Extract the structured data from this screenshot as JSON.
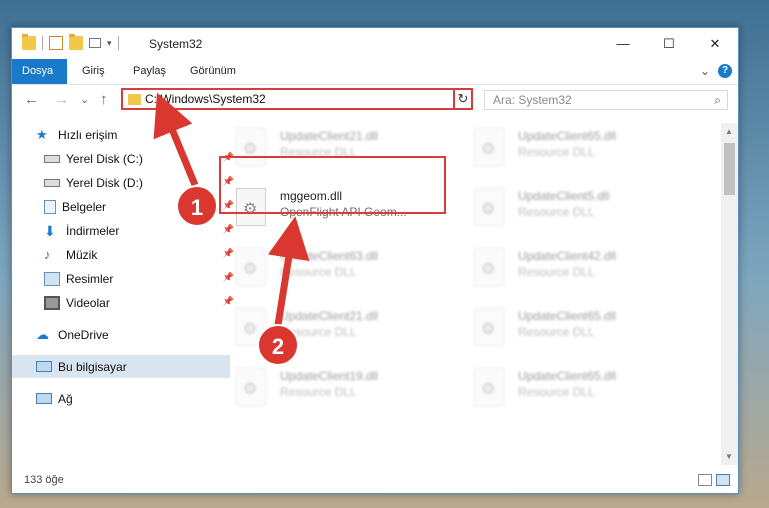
{
  "window": {
    "title": "System32",
    "controls": {
      "minimize": "—",
      "maximize": "☐",
      "close": "✕"
    }
  },
  "ribbon": {
    "tabs": [
      "Dosya",
      "Giriş",
      "Paylaş",
      "Görünüm"
    ],
    "expand": "⌄",
    "help": "?"
  },
  "navigation": {
    "back": "←",
    "forward": "→",
    "recent": "⌄",
    "up": "↑",
    "address": "C:\\Windows\\System32",
    "address_dropdown": "⌄",
    "refresh": "↻",
    "search_placeholder": "Ara: System32",
    "search_icon": "⌕"
  },
  "sidebar": {
    "items": [
      {
        "label": "Hızlı erişim",
        "icon": "star-icon",
        "pinned": false
      },
      {
        "label": "Yerel Disk (C:)",
        "icon": "drive-icon",
        "pinned": true
      },
      {
        "label": "Yerel Disk (D:)",
        "icon": "drive-icon",
        "pinned": true
      },
      {
        "label": "Belgeler",
        "icon": "document-icon",
        "pinned": true
      },
      {
        "label": "İndirmeler",
        "icon": "download-icon",
        "pinned": true
      },
      {
        "label": "Müzik",
        "icon": "music-icon",
        "pinned": true
      },
      {
        "label": "Resimler",
        "icon": "pictures-icon",
        "pinned": true
      },
      {
        "label": "Videolar",
        "icon": "video-icon",
        "pinned": true
      },
      {
        "label": "OneDrive",
        "icon": "cloud-icon",
        "pinned": false
      },
      {
        "label": "Bu bilgisayar",
        "icon": "computer-icon",
        "pinned": false,
        "selected": true
      },
      {
        "label": "Ağ",
        "icon": "network-icon",
        "pinned": false
      }
    ]
  },
  "files": [
    {
      "name": "UpdateClient21.dll",
      "desc": "Resource DLL",
      "blurred": true
    },
    {
      "name": "UpdateClient65.dll",
      "desc": "Resource DLL",
      "blurred": true
    },
    {
      "name": "mggeom.dll",
      "desc": "OpenFlight API Geom...",
      "blurred": false,
      "highlighted": true
    },
    {
      "name": "UpdateClient5.dll",
      "desc": "Resource DLL",
      "blurred": true
    },
    {
      "name": "UpdateClient63.dll",
      "desc": "Resource DLL",
      "blurred": true
    },
    {
      "name": "UpdateClient42.dll",
      "desc": "Resource DLL",
      "blurred": true
    },
    {
      "name": "UpdateClient21.dll",
      "desc": "Resource DLL",
      "blurred": true
    },
    {
      "name": "UpdateClient65.dll",
      "desc": "Resource DLL",
      "blurred": true
    },
    {
      "name": "UpdateClient19.dll",
      "desc": "Resource DLL",
      "blurred": true
    },
    {
      "name": "UpdateClient65.dll",
      "desc": "Resource DLL",
      "blurred": true
    }
  ],
  "status": {
    "count": "133 öğe"
  },
  "markers": {
    "one": "1",
    "two": "2"
  },
  "colors": {
    "accent": "#1979ca",
    "highlight": "#d93c3c",
    "marker": "#d9372f"
  }
}
